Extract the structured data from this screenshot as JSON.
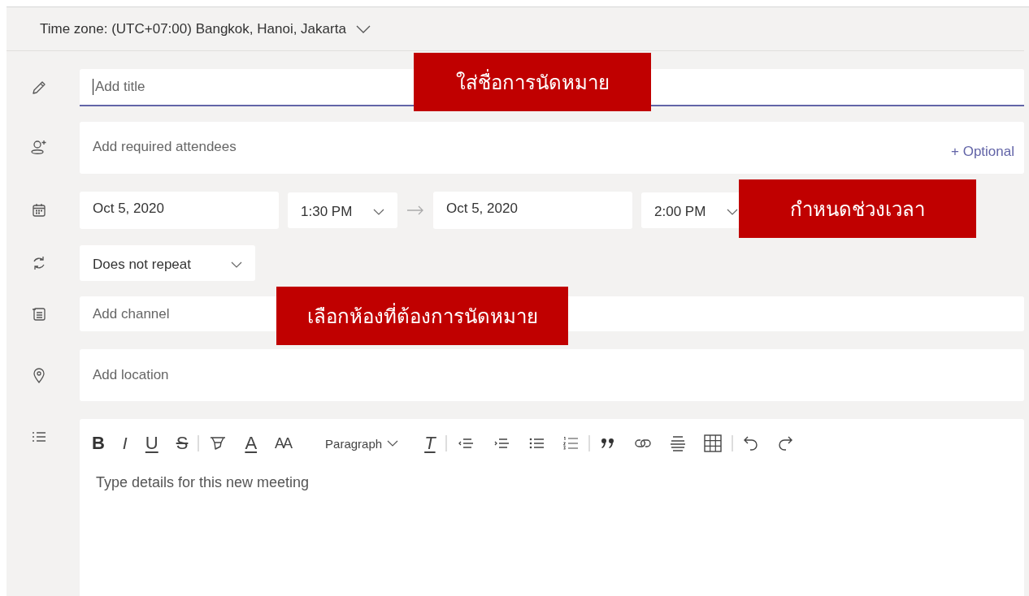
{
  "time_zone": {
    "label": "Time zone: (UTC+07:00) Bangkok, Hanoi, Jakarta"
  },
  "title_field": {
    "placeholder": "Add title"
  },
  "attendees": {
    "placeholder": "Add required attendees",
    "optional_link": "+ Optional"
  },
  "schedule": {
    "start_date": "Oct 5, 2020",
    "start_time": "1:30 PM",
    "end_date": "Oct 5, 2020",
    "end_time": "2:00 PM"
  },
  "repeat": {
    "value": "Does not repeat"
  },
  "channel": {
    "placeholder": "Add channel"
  },
  "location": {
    "placeholder": "Add location"
  },
  "editor": {
    "toolbar": [
      {
        "kind": "bold",
        "label": "B"
      },
      {
        "kind": "italic",
        "label": "I"
      },
      {
        "kind": "underline",
        "label": "U"
      },
      {
        "kind": "strike",
        "label": "S"
      },
      {
        "kind": "separator"
      },
      {
        "kind": "highlight"
      },
      {
        "kind": "font-color",
        "label": "A"
      },
      {
        "kind": "font-size",
        "label": "AA"
      },
      {
        "kind": "dropdown",
        "label": "Paragraph"
      },
      {
        "kind": "clear",
        "label": "T"
      },
      {
        "kind": "separator"
      },
      {
        "kind": "outdent"
      },
      {
        "kind": "indent"
      },
      {
        "kind": "bullets"
      },
      {
        "kind": "numbers"
      },
      {
        "kind": "separator"
      },
      {
        "kind": "quote"
      },
      {
        "kind": "link"
      },
      {
        "kind": "rule"
      },
      {
        "kind": "table"
      },
      {
        "kind": "separator"
      },
      {
        "kind": "undo"
      },
      {
        "kind": "redo"
      }
    ],
    "placeholder": "Type details for this new meeting"
  },
  "callouts": [
    {
      "text": "ใส่ชื่อการนัดหมาย"
    },
    {
      "text": "กำหนดช่วงเวลา"
    },
    {
      "text": "เลือกห้องที่ต้องการนัดหมาย"
    }
  ]
}
